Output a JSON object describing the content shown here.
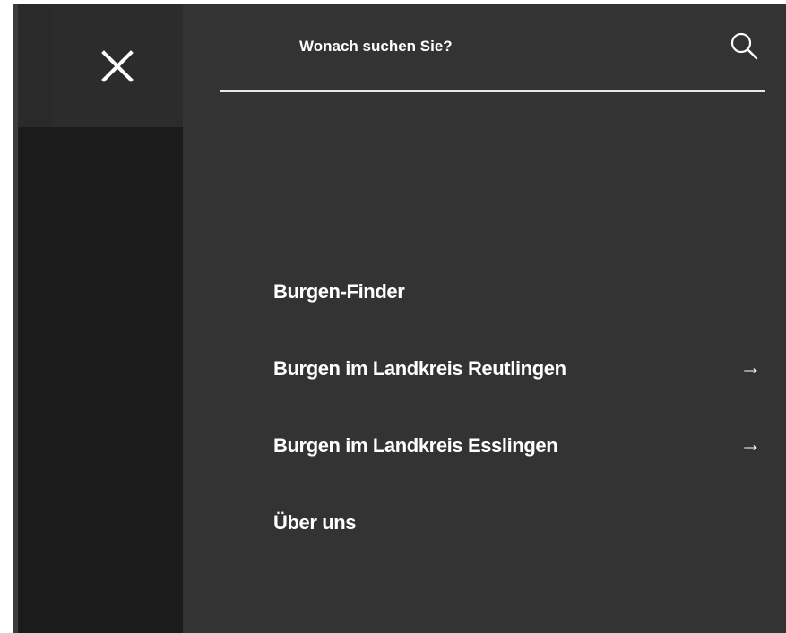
{
  "header": {
    "close_label": "Menü schließen"
  },
  "search": {
    "placeholder": "Wonach suchen Sie?",
    "value": ""
  },
  "nav": {
    "items": [
      {
        "label": "Burgen-Finder",
        "arrow": ""
      },
      {
        "label": "Burgen im Landkreis Reutlingen",
        "arrow": "→"
      },
      {
        "label": "Burgen im Landkreis Esslingen",
        "arrow": "→"
      },
      {
        "label": "Über uns",
        "arrow": ""
      }
    ]
  },
  "colors": {
    "panel": "#333333",
    "background": "#1b1b1b",
    "text": "#ffffff"
  },
  "icons": [
    "close-icon",
    "search-icon",
    "arrow-right-icon"
  ]
}
